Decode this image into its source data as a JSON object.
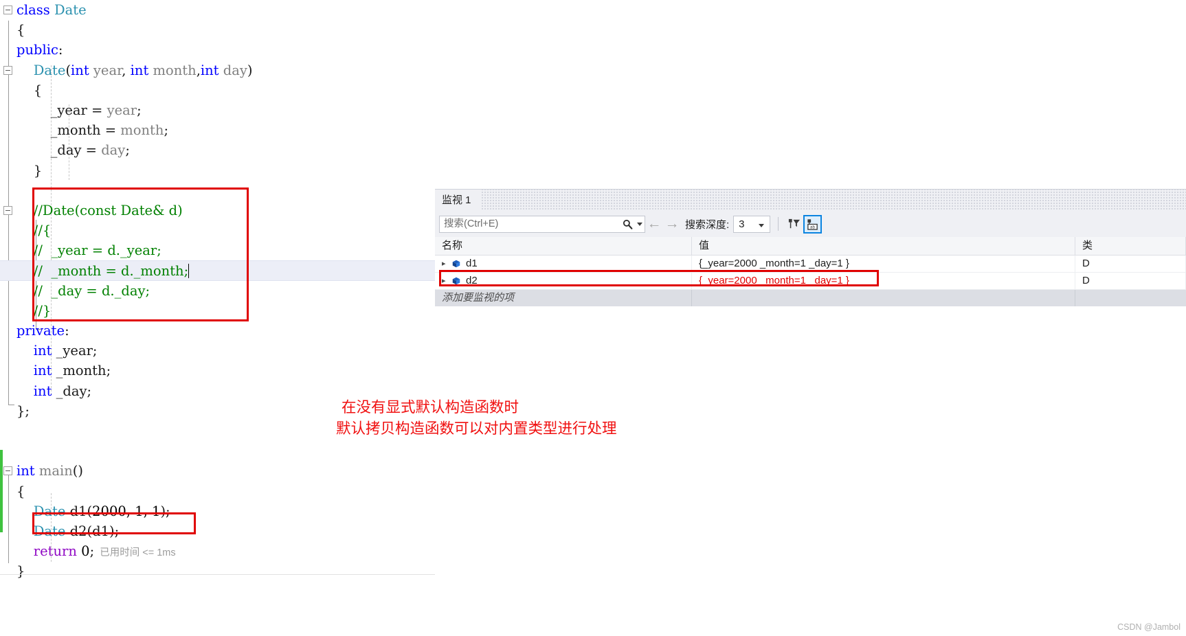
{
  "editor": {
    "lines": [
      {
        "indent": 0,
        "fold": true,
        "tokens": [
          {
            "t": "kw",
            "v": "class"
          },
          {
            "t": "pln",
            "v": " "
          },
          {
            "t": "typ",
            "v": "Date"
          }
        ]
      },
      {
        "indent": 1,
        "fold": false,
        "tokens": [
          {
            "t": "pln",
            "v": "{"
          }
        ]
      },
      {
        "indent": 1,
        "fold": false,
        "tokens": [
          {
            "t": "kw",
            "v": "public"
          },
          {
            "t": "pln",
            "v": ":"
          }
        ]
      },
      {
        "indent": 1,
        "fold": true,
        "tokens": [
          {
            "t": "pln",
            "v": "    "
          },
          {
            "t": "typ",
            "v": "Date"
          },
          {
            "t": "pln",
            "v": "("
          },
          {
            "t": "kw",
            "v": "int"
          },
          {
            "t": "id",
            "v": " year"
          },
          {
            "t": "pln",
            "v": ", "
          },
          {
            "t": "kw",
            "v": "int"
          },
          {
            "t": "id",
            "v": " month"
          },
          {
            "t": "pln",
            "v": ","
          },
          {
            "t": "kw",
            "v": "int"
          },
          {
            "t": "id",
            "v": " day"
          },
          {
            "t": "pln",
            "v": ")"
          }
        ]
      },
      {
        "indent": 1,
        "fold": false,
        "tokens": [
          {
            "t": "pln",
            "v": "    {"
          }
        ]
      },
      {
        "indent": 1,
        "fold": false,
        "tokens": [
          {
            "t": "pln",
            "v": "        _year = "
          },
          {
            "t": "id",
            "v": "year"
          },
          {
            "t": "pln",
            "v": ";"
          }
        ]
      },
      {
        "indent": 1,
        "fold": false,
        "tokens": [
          {
            "t": "pln",
            "v": "        _month = "
          },
          {
            "t": "id",
            "v": "month"
          },
          {
            "t": "pln",
            "v": ";"
          }
        ]
      },
      {
        "indent": 1,
        "fold": false,
        "tokens": [
          {
            "t": "pln",
            "v": "        _day = "
          },
          {
            "t": "id",
            "v": "day"
          },
          {
            "t": "pln",
            "v": ";"
          }
        ]
      },
      {
        "indent": 1,
        "fold": false,
        "tokens": [
          {
            "t": "pln",
            "v": "    }"
          }
        ]
      },
      {
        "indent": 1,
        "fold": false,
        "tokens": []
      },
      {
        "indent": 1,
        "fold": true,
        "tokens": [
          {
            "t": "cmt",
            "v": "    //Date(const Date& d)"
          }
        ]
      },
      {
        "indent": 1,
        "fold": false,
        "tokens": [
          {
            "t": "cmt",
            "v": "    //{"
          }
        ]
      },
      {
        "indent": 1,
        "fold": false,
        "tokens": [
          {
            "t": "cmt",
            "v": "    //  _year = d._year;"
          }
        ]
      },
      {
        "indent": 1,
        "fold": false,
        "highlight": true,
        "caret": true,
        "tokens": [
          {
            "t": "cmt",
            "v": "    //  _month = d._month;"
          }
        ]
      },
      {
        "indent": 1,
        "fold": false,
        "tokens": [
          {
            "t": "cmt",
            "v": "    //  _day = d._day;"
          }
        ]
      },
      {
        "indent": 1,
        "fold": false,
        "tokens": [
          {
            "t": "cmt",
            "v": "    //}"
          }
        ]
      },
      {
        "indent": 1,
        "fold": false,
        "tokens": [
          {
            "t": "kw",
            "v": "private"
          },
          {
            "t": "pln",
            "v": ":"
          }
        ]
      },
      {
        "indent": 1,
        "fold": false,
        "tokens": [
          {
            "t": "pln",
            "v": "    "
          },
          {
            "t": "kw",
            "v": "int"
          },
          {
            "t": "pln",
            "v": " _year;"
          }
        ]
      },
      {
        "indent": 1,
        "fold": false,
        "tokens": [
          {
            "t": "pln",
            "v": "    "
          },
          {
            "t": "kw",
            "v": "int"
          },
          {
            "t": "pln",
            "v": " _month;"
          }
        ]
      },
      {
        "indent": 1,
        "fold": false,
        "tokens": [
          {
            "t": "pln",
            "v": "    "
          },
          {
            "t": "kw",
            "v": "int"
          },
          {
            "t": "pln",
            "v": " _day;"
          }
        ]
      },
      {
        "indent": 0,
        "fold": false,
        "tokens": [
          {
            "t": "pln",
            "v": "};"
          }
        ]
      },
      {
        "indent": 0,
        "fold": false,
        "tokens": []
      },
      {
        "indent": 0,
        "fold": false,
        "tokens": []
      },
      {
        "indent": 0,
        "fold": true,
        "tokens": [
          {
            "t": "kw",
            "v": "int"
          },
          {
            "t": "pln",
            "v": " "
          },
          {
            "t": "id",
            "v": "main"
          },
          {
            "t": "pln",
            "v": "()"
          }
        ]
      },
      {
        "indent": 1,
        "fold": false,
        "tokens": [
          {
            "t": "pln",
            "v": "{"
          }
        ]
      },
      {
        "indent": 1,
        "fold": false,
        "tokens": [
          {
            "t": "pln",
            "v": "    "
          },
          {
            "t": "typ",
            "v": "Date"
          },
          {
            "t": "pln",
            "v": " d1("
          },
          {
            "t": "num",
            "v": "2000"
          },
          {
            "t": "pln",
            "v": ", "
          },
          {
            "t": "num",
            "v": "1"
          },
          {
            "t": "pln",
            "v": ", "
          },
          {
            "t": "num",
            "v": "1"
          },
          {
            "t": "pln",
            "v": ");"
          }
        ]
      },
      {
        "indent": 1,
        "fold": false,
        "tokens": [
          {
            "t": "pln",
            "v": "    "
          },
          {
            "t": "typ",
            "v": "Date"
          },
          {
            "t": "pln",
            "v": " d2(d1);"
          }
        ]
      },
      {
        "indent": 1,
        "fold": false,
        "elapsed": "已用时间 <= 1ms",
        "tokens": [
          {
            "t": "pln",
            "v": "    "
          },
          {
            "t": "ret",
            "v": "return"
          },
          {
            "t": "pln",
            "v": " "
          },
          {
            "t": "num",
            "v": "0"
          },
          {
            "t": "pln",
            "v": ";"
          }
        ]
      },
      {
        "indent": 1,
        "fold": false,
        "tokens": [
          {
            "t": "pln",
            "v": "}"
          }
        ]
      }
    ]
  },
  "watch": {
    "tab_label": "监视 1",
    "search": {
      "placeholder": "搜索(Ctrl+E)",
      "value": "",
      "icon": "search-icon"
    },
    "nav_prev": "←",
    "nav_next": "→",
    "depth_label": "搜索深度:",
    "depth_value": "3",
    "buttons": [
      {
        "name": "pin-filter-icon",
        "label": ""
      },
      {
        "name": "hexadecimal-display-icon",
        "label": "",
        "active": true
      }
    ],
    "columns": [
      "名称",
      "值",
      "类"
    ],
    "rows": [
      {
        "name": "d1",
        "value": "{_year=2000 _month=1 _day=1 }",
        "type": "D",
        "highlight": false
      },
      {
        "name": "d2",
        "value": "{_year=2000 _month=1 _day=1 }",
        "type": "D",
        "highlight": true
      }
    ],
    "add_row_placeholder": "添加要监视的项"
  },
  "annotation": {
    "line1": "在没有显式默认构造函数时",
    "line2": "默认拷贝构造函数可以对内置类型进行处理",
    "color": "#f01010"
  },
  "watermark": "CSDN @Jambol"
}
